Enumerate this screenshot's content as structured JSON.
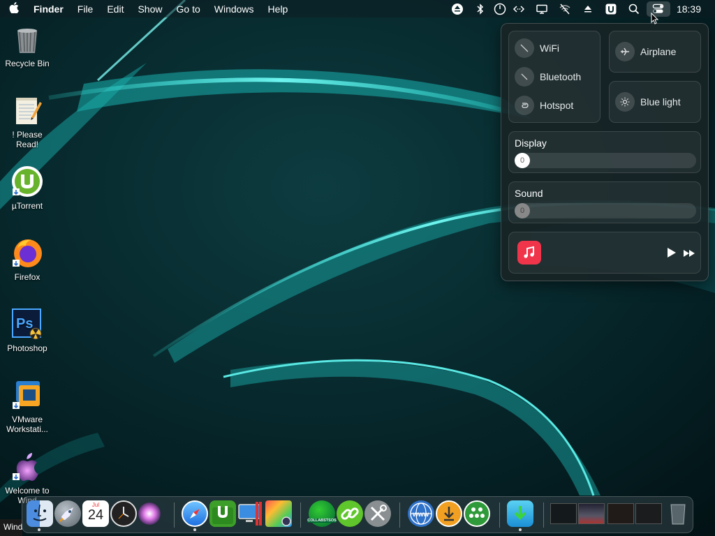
{
  "menubar": {
    "app_menu": "Finder",
    "items": [
      "File",
      "Edit",
      "Show",
      "Go to",
      "Windows",
      "Help"
    ],
    "clock": "18:39",
    "status_icons": [
      "eject-icon",
      "bluetooth-icon",
      "timer-icon",
      "code-icon",
      "display-icon",
      "wifi-off-icon",
      "eject-icon",
      "u-app-icon",
      "search-icon",
      "control-center-icon"
    ]
  },
  "desktop": {
    "icons": [
      {
        "label": "Recycle Bin",
        "icon": "recycle-bin-icon"
      },
      {
        "label": "! Please Read!",
        "icon": "notepad-icon"
      },
      {
        "label": "µTorrent",
        "icon": "utorrent-icon"
      },
      {
        "label": "Firefox",
        "icon": "firefox-icon"
      },
      {
        "label": "Photoshop",
        "icon": "photoshop-icon"
      },
      {
        "label": "VMware Workstati...",
        "icon": "vmware-icon"
      },
      {
        "label": "Welcome to Wind",
        "icon": "apple-welcome-icon"
      }
    ]
  },
  "control_center": {
    "wifi": "WiFi",
    "bluetooth": "Bluetooth",
    "hotspot": "Hotspot",
    "airplane": "Airplane",
    "blue_light": "Blue light",
    "display": {
      "label": "Display",
      "value": "0",
      "level": 0
    },
    "sound": {
      "label": "Sound",
      "value": "0",
      "level": 0
    },
    "music_icon": "music-note-icon",
    "play_icon": "play-icon",
    "next_icon": "fast-forward-icon"
  },
  "taskbar": {
    "start_text": "Windows"
  },
  "dock": {
    "items": [
      "finder-icon",
      "launchpad-icon",
      "calendar-icon",
      "clock-icon",
      "siri-icon",
      "safari-icon",
      "utorrent-icon",
      "remote-desktop-icon",
      "photo-booth-icon",
      "collabstsos-icon",
      "link-icon",
      "tools-icon",
      "www-icon",
      "download-icon",
      "network-icon",
      "downloads-folder-icon",
      "window-thumbnail-1",
      "window-thumbnail-2",
      "window-thumbnail-3",
      "window-thumbnail-4",
      "trash-icon"
    ],
    "calendar_month": "Jul",
    "calendar_day": "24",
    "collab_label": "COLLABSTSOS"
  },
  "colors": {
    "accent": "#2bd7d0",
    "wallpaper": "#06262b",
    "music": "#f0354b"
  }
}
